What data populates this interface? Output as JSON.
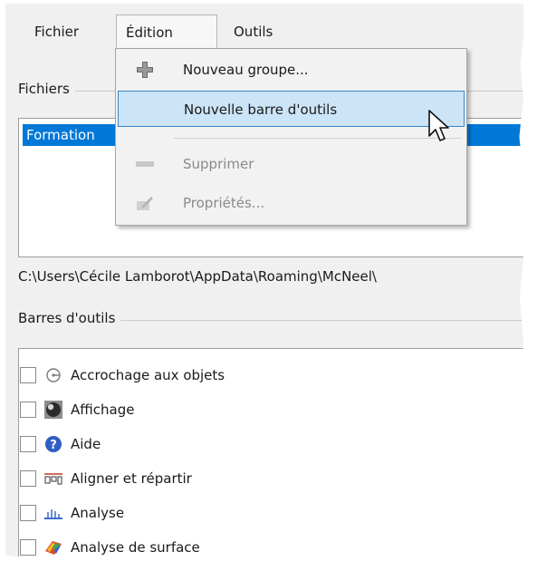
{
  "menubar": {
    "items": [
      {
        "label": "Fichier"
      },
      {
        "label": "Édition",
        "active": true
      },
      {
        "label": "Outils"
      }
    ]
  },
  "files_group": {
    "label": "Fichiers",
    "selected_item": "Formation",
    "path": "C:\\Users\\Cécile Lamborot\\AppData\\Roaming\\McNeel\\"
  },
  "toolbars_group": {
    "label": "Barres d'outils",
    "items": [
      {
        "label": "Accrochage aux objets",
        "icon": "snap-icon"
      },
      {
        "label": "Affichage",
        "icon": "sphere-icon"
      },
      {
        "label": "Aide",
        "icon": "help-icon"
      },
      {
        "label": "Aligner et répartir",
        "icon": "align-icon"
      },
      {
        "label": "Analyse",
        "icon": "analysis-icon"
      },
      {
        "label": "Analyse de surface",
        "icon": "surface-analysis-icon"
      }
    ]
  },
  "edit_menu": {
    "items": [
      {
        "label": "Nouveau groupe...",
        "icon": "plus-icon",
        "enabled": true
      },
      {
        "label": "Nouvelle barre d'outils",
        "icon": "",
        "enabled": true,
        "highlighted": true
      },
      {
        "label": "Supprimer",
        "icon": "minus-icon",
        "enabled": false
      },
      {
        "label": "Propriétés...",
        "icon": "properties-icon",
        "enabled": false
      }
    ]
  },
  "colors": {
    "selection": "#0078d7",
    "menu_highlight": "#cce4f7",
    "menu_highlight_border": "#3a86c8",
    "disabled_text": "#8a8a8a"
  }
}
